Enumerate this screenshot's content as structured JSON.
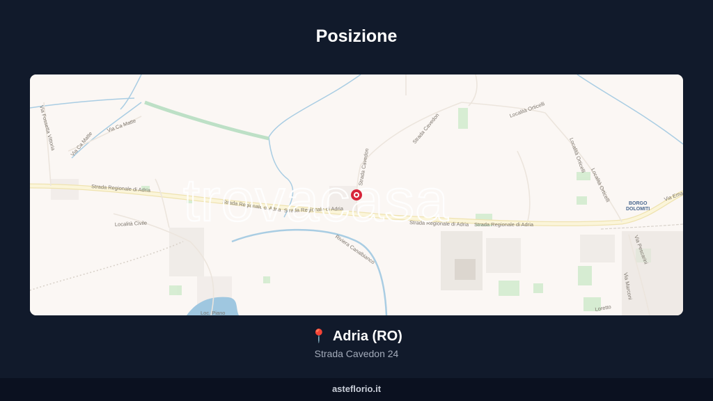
{
  "page": {
    "title": "Posizione"
  },
  "map": {
    "watermark": "trovacasa",
    "labels": {
      "strada_regionale_west": "Strada Regionale di Adria",
      "strada_regionale_mid1": "Strada Regionale di Adria",
      "strada_regionale_mid2": "Strada Regionale di Adria",
      "strada_regionale_east1": "Strada Regionale di Adria",
      "strada_regionale_east2": "Strada Regionale di Adria",
      "via_ca_matte_1": "Via Ca Matte",
      "via_ca_matte_2": "Via Ca Matte",
      "via_fossetta": "Via Fossetta Vittoria",
      "localita_civile": "Località Civile",
      "riviera": "Riviera Canalbianco",
      "strada_cavedon": "Strada Cavedon",
      "strada_cavedon_2": "Strada Cavedon",
      "localita_orticelli": "Località Orticelli",
      "localita_orticelli_2": "Località Orticelli",
      "localita_orticelli_3": "Località Orticelli",
      "borgo_1": "BORGO",
      "borgo_2": "DOLOMITI",
      "via_ema": "Via Ema",
      "via_pescarini": "Via Pescarini",
      "via_marconi": "Via Marconi",
      "loc_piano": "Loc. Piano",
      "via_loretto": "Loretto"
    },
    "colors": {
      "water": "#a9cde3",
      "green": "#cfe9cf",
      "road": "#f6efc8",
      "marker": "#d7253a"
    }
  },
  "location": {
    "pin_icon": "📍",
    "city": "Adria (RO)",
    "address": "Strada Cavedon 24"
  },
  "footer": {
    "site": "asteflorio.it"
  }
}
